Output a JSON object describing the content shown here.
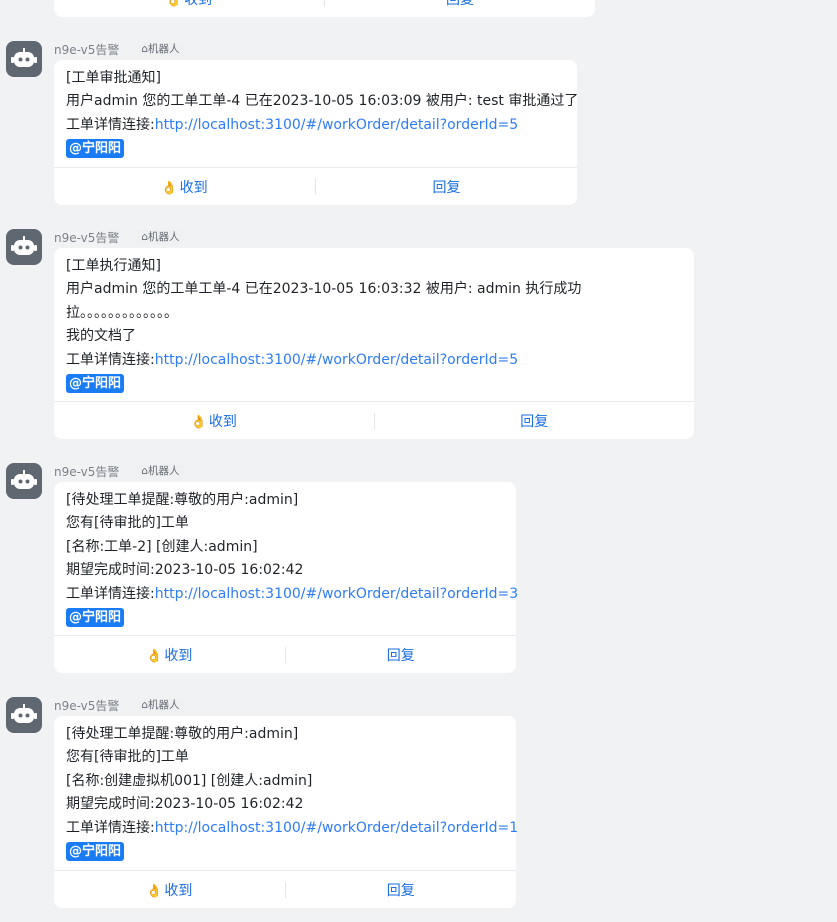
{
  "top_partial": {
    "received_label": "收到",
    "reply_label": "回复"
  },
  "messages": [
    {
      "sender": "n9e-v5告警",
      "badge": "机器人",
      "lines": [
        "[工单审批通知]",
        " 用户admin 您的工单工单-4 已在2023-10-05 16:03:09 被用户: test 审批通过了"
      ],
      "link_prefix": "工单详情连接:",
      "link": "http://localhost:3100/#/workOrder/detail?orderId=5",
      "mention": "@宁阳阳",
      "received_label": "收到",
      "reply_label": "回复"
    },
    {
      "sender": "n9e-v5告警",
      "badge": "机器人",
      "lines": [
        "[工单执行通知]",
        " 用户admin 您的工单工单-4 已在2023-10-05 16:03:32 被用户: admin 执行成功",
        "拉。。。。。。。。。。。。。",
        "我的文档了"
      ],
      "link_prefix": "工单详情连接:",
      "link": "http://localhost:3100/#/workOrder/detail?orderId=5",
      "mention": "@宁阳阳",
      "received_label": "收到",
      "reply_label": "回复"
    },
    {
      "sender": "n9e-v5告警",
      "badge": "机器人",
      "lines": [
        "[待处理工单提醒:尊敬的用户:admin]",
        " 您有[待审批的]工单",
        "[名称:工单-2] [创建人:admin]",
        "期望完成时间:2023-10-05 16:02:42"
      ],
      "link_prefix": "工单详情连接:",
      "link": "http://localhost:3100/#/workOrder/detail?orderId=3",
      "mention": "@宁阳阳",
      "received_label": "收到",
      "reply_label": "回复"
    },
    {
      "sender": "n9e-v5告警",
      "badge": "机器人",
      "lines": [
        "[待处理工单提醒:尊敬的用户:admin]",
        " 您有[待审批的]工单",
        "[名称:创建虚拟机001] [创建人:admin]",
        "期望完成时间:2023-10-05 16:02:42"
      ],
      "link_prefix": "工单详情连接:",
      "link": "http://localhost:3100/#/workOrder/detail?orderId=1",
      "mention": "@宁阳阳",
      "received_label": "收到",
      "reply_label": "回复"
    }
  ],
  "icons": {
    "avatar": "robot-icon",
    "badge": "robot-small-icon",
    "received": "ok-hand-icon"
  },
  "colors": {
    "link": "#2e7cf6",
    "mention_bg": "#1a7cf5",
    "action": "#1a6ee3",
    "avatar_bg": "#5f6770",
    "page_bg": "#f1f2f4"
  }
}
